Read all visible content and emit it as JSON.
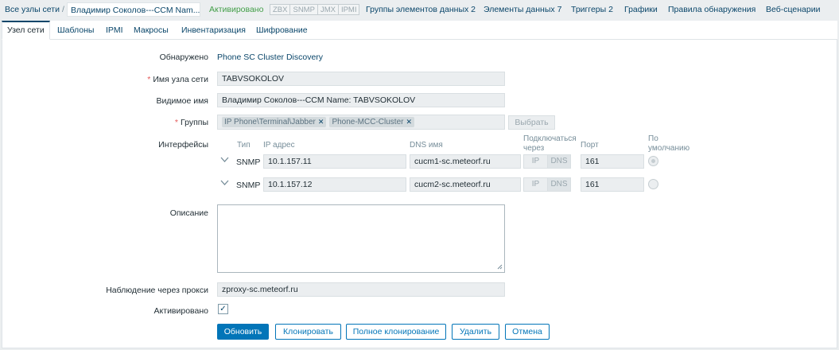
{
  "nav": {
    "all_hosts": "Все узлы сети",
    "separator": "/",
    "host_name": "Владимир Соколов---CCM Nam...",
    "status": "Активировано",
    "availability": [
      "ZBX",
      "SNMP",
      "JMX",
      "IPMI"
    ],
    "links": [
      "Группы элементов данных 2",
      "Элементы данных 7",
      "Триггеры 2",
      "Графики",
      "Правила обнаружения",
      "Веб-сценарии"
    ]
  },
  "tabs": [
    "Узел сети",
    "Шаблоны",
    "IPMI",
    "Макросы",
    "Инвентаризация",
    "Шифрование"
  ],
  "form": {
    "discovered_label": "Обнаружено",
    "discovered_value": "Phone SC Cluster Discovery",
    "required_mark": "*",
    "host_name_label": "Имя узла сети",
    "host_name_value": "TABVSOKOLOV",
    "visible_name_label": "Видимое имя",
    "visible_name_value": "Владимир Соколов---CCM Name: TABVSOKOLOV",
    "groups_label": "Группы",
    "groups": [
      "IP Phone\\Terminal\\Jabber",
      "Phone-MCC-Cluster"
    ],
    "remove_mark": "✕",
    "select_button": "Выбрать",
    "interfaces_label": "Интерфейсы",
    "interfaces_headers": {
      "type": "Тип",
      "ip": "IP адрес",
      "dns": "DNS имя",
      "connect_via_1": "Подключаться",
      "connect_via_2": "через",
      "port": "Порт",
      "default_1": "По",
      "default_2": "умолчанию"
    },
    "interfaces": [
      {
        "type": "SNMP",
        "ip": "10.1.157.11",
        "dns": "cucm1-sc.meteorf.ru",
        "connect_ip": "IP",
        "connect_dns": "DNS",
        "port": "161",
        "default": true
      },
      {
        "type": "SNMP",
        "ip": "10.1.157.12",
        "dns": "cucm2-sc.meteorf.ru",
        "connect_ip": "IP",
        "connect_dns": "DNS",
        "port": "161",
        "default": false
      }
    ],
    "description_label": "Описание",
    "description_value": "",
    "proxy_label": "Наблюдение через прокси",
    "proxy_value": "zproxy-sc.meteorf.ru",
    "enabled_label": "Активировано",
    "enabled_checked": true,
    "check_mark": "✓"
  },
  "buttons": {
    "update": "Обновить",
    "clone": "Клонировать",
    "full_clone": "Полное клонирование",
    "delete": "Удалить",
    "cancel": "Отмена"
  },
  "colors": {
    "accent": "#0275b8",
    "link": "#0a466a",
    "enabled": "#429e47",
    "required": "#e45959"
  }
}
